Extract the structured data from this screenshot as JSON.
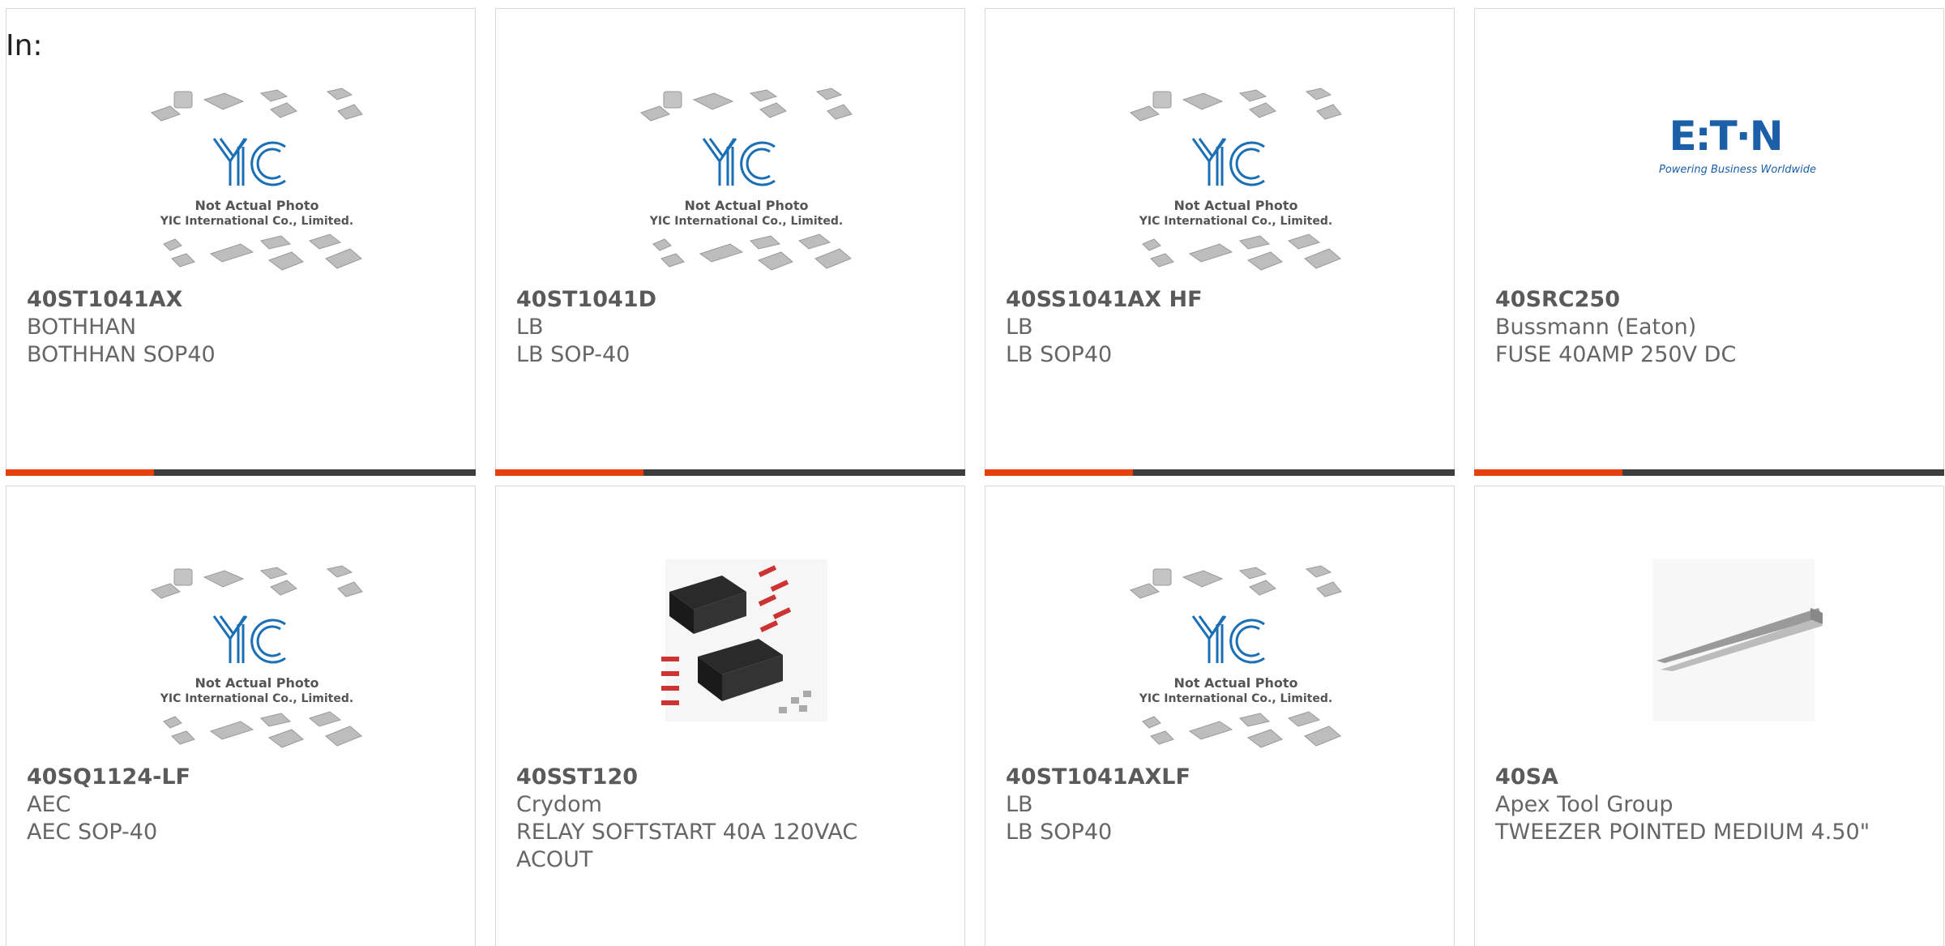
{
  "filter": {
    "label": "In:"
  },
  "products": [
    {
      "part": "40ST1041AX",
      "brand": "BOTHHAN",
      "desc": "BOTHHAN SOP40",
      "image": "yic-placeholder"
    },
    {
      "part": "40ST1041D",
      "brand": "LB",
      "desc": "LB SOP-40",
      "image": "yic-placeholder"
    },
    {
      "part": "40SS1041AX HF",
      "brand": "LB",
      "desc": "LB SOP40",
      "image": "yic-placeholder"
    },
    {
      "part": "40SRC250",
      "brand": "Bussmann (Eaton)",
      "desc": "FUSE 40AMP 250V DC",
      "image": "eaton-logo"
    },
    {
      "part": "40SQ1124-LF",
      "brand": "AEC",
      "desc": "AEC SOP-40",
      "image": "yic-placeholder"
    },
    {
      "part": "40SST120",
      "brand": "Crydom",
      "desc": "RELAY SOFTSTART 40A 120VAC ACOUT",
      "image": "relay-photo"
    },
    {
      "part": "40ST1041AXLF",
      "brand": "LB",
      "desc": "LB SOP40",
      "image": "yic-placeholder"
    },
    {
      "part": "40SA",
      "brand": "Apex Tool Group",
      "desc": "TWEEZER POINTED MEDIUM 4.50\"",
      "image": "tweezer-photo"
    }
  ],
  "placeholder": {
    "line1": "Not Actual Photo",
    "line2": "YIC International Co., Limited.",
    "logo": "YIC"
  },
  "eaton": {
    "logo": "E:T·N",
    "tagline": "Powering Business Worldwide"
  },
  "colors": {
    "accent": "#e8400c",
    "bar": "#3d3d3d",
    "yic_blue": "#1a6fb5",
    "eaton_blue": "#1b5fa8"
  }
}
